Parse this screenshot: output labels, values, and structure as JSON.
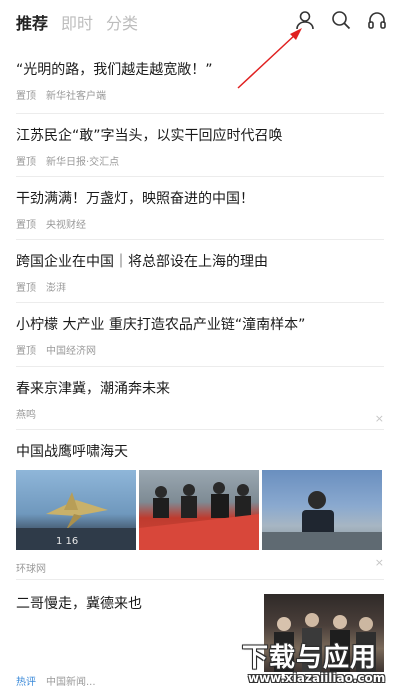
{
  "header": {
    "tabs": [
      {
        "label": "推荐",
        "active": true
      },
      {
        "label": "即时",
        "active": false
      },
      {
        "label": "分类",
        "active": false
      }
    ],
    "icons": [
      "user-icon",
      "search-icon",
      "headphones-icon"
    ]
  },
  "feed": [
    {
      "title": "“光明的路，我们越走越宽敞！”",
      "tag": "置顶",
      "source": "新华社客户端"
    },
    {
      "title": "江苏民企“敢”字当头，以实干回应时代召唤",
      "tag": "置顶",
      "source": "新华日报·交汇点"
    },
    {
      "title": "干劲满满！万盏灯，映照奋进的中国！",
      "tag": "置顶",
      "source": "央视财经"
    },
    {
      "title": "跨国企业在中国｜将总部设在上海的理由",
      "tag": "置顶",
      "source": "澎湃"
    },
    {
      "title": "小柠檬 大产业 重庆打造农品产业链“潼南样本”",
      "tag": "置顶",
      "source": "中国经济网"
    },
    {
      "title": "春来京津冀，潮涌奔未来",
      "source": "燕鸣",
      "close": "×"
    },
    {
      "title": "中国战鹰呼啸海天",
      "source": "环球网",
      "close": "×"
    },
    {
      "title": "二哥慢走，冀德来也",
      "tag": "热评",
      "source": "中国新闻..."
    }
  ],
  "watermark": {
    "title": "下载与应用",
    "url": "www.xiazaiiliao.com"
  },
  "colors": {
    "hot_tag": "#3b8ad9",
    "arrow": "#e02020"
  }
}
